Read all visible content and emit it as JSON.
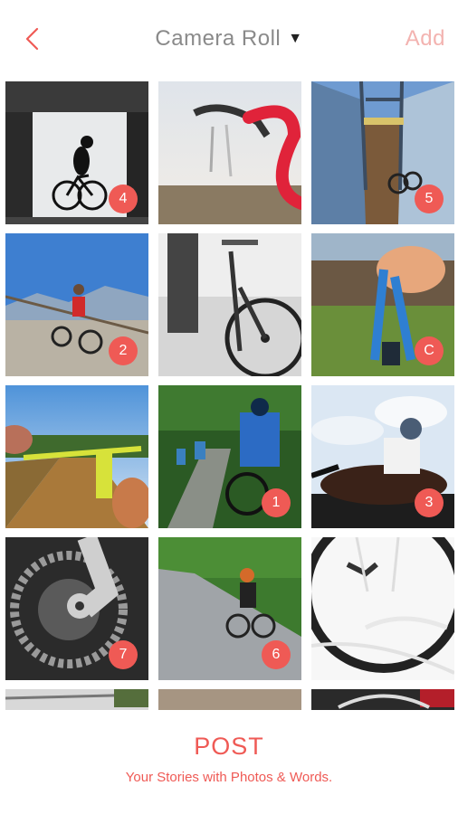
{
  "header": {
    "back_icon": "chevron-left-icon",
    "title": "Camera Roll",
    "dropdown_icon": "caret-down-icon",
    "add_label": "Add",
    "accent_color": "#ef5a55",
    "add_color": "#f3b3b0"
  },
  "grid": {
    "photos": [
      {
        "subject": "cyclist silhouette in tunnel",
        "badge": "4"
      },
      {
        "subject": "red handlebar close-up",
        "badge": ""
      },
      {
        "subject": "bridge with bicycle",
        "badge": "5"
      },
      {
        "subject": "cyclist on mountain road",
        "badge": "2"
      },
      {
        "subject": "black and white bicycle wheel",
        "badge": ""
      },
      {
        "subject": "hand holding blue lanyard",
        "badge": "C"
      },
      {
        "subject": "riding POV road",
        "badge": ""
      },
      {
        "subject": "group cycling forest path",
        "badge": "1"
      },
      {
        "subject": "cyclist low angle sky",
        "badge": "3"
      },
      {
        "subject": "chainring gear close-up",
        "badge": "7"
      },
      {
        "subject": "cyclist on park path",
        "badge": "6"
      },
      {
        "subject": "bicycle wheel close-up",
        "badge": ""
      },
      {
        "subject": "partial photo",
        "badge": ""
      },
      {
        "subject": "partial photo",
        "badge": ""
      },
      {
        "subject": "partial photo",
        "badge": ""
      }
    ]
  },
  "footer": {
    "post_label": "POST",
    "tagline": "Your Stories with Photos & Words."
  }
}
